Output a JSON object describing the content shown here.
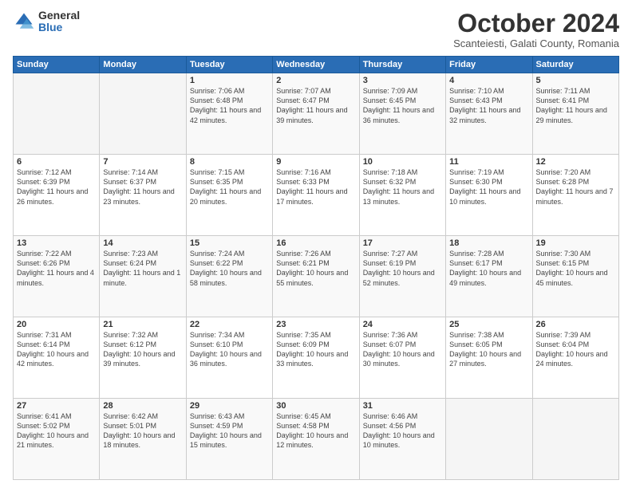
{
  "header": {
    "logo_general": "General",
    "logo_blue": "Blue",
    "month": "October 2024",
    "location": "Scanteiesti, Galati County, Romania"
  },
  "days_of_week": [
    "Sunday",
    "Monday",
    "Tuesday",
    "Wednesday",
    "Thursday",
    "Friday",
    "Saturday"
  ],
  "weeks": [
    [
      {
        "day": "",
        "info": ""
      },
      {
        "day": "",
        "info": ""
      },
      {
        "day": "1",
        "info": "Sunrise: 7:06 AM\nSunset: 6:48 PM\nDaylight: 11 hours and 42 minutes."
      },
      {
        "day": "2",
        "info": "Sunrise: 7:07 AM\nSunset: 6:47 PM\nDaylight: 11 hours and 39 minutes."
      },
      {
        "day": "3",
        "info": "Sunrise: 7:09 AM\nSunset: 6:45 PM\nDaylight: 11 hours and 36 minutes."
      },
      {
        "day": "4",
        "info": "Sunrise: 7:10 AM\nSunset: 6:43 PM\nDaylight: 11 hours and 32 minutes."
      },
      {
        "day": "5",
        "info": "Sunrise: 7:11 AM\nSunset: 6:41 PM\nDaylight: 11 hours and 29 minutes."
      }
    ],
    [
      {
        "day": "6",
        "info": "Sunrise: 7:12 AM\nSunset: 6:39 PM\nDaylight: 11 hours and 26 minutes."
      },
      {
        "day": "7",
        "info": "Sunrise: 7:14 AM\nSunset: 6:37 PM\nDaylight: 11 hours and 23 minutes."
      },
      {
        "day": "8",
        "info": "Sunrise: 7:15 AM\nSunset: 6:35 PM\nDaylight: 11 hours and 20 minutes."
      },
      {
        "day": "9",
        "info": "Sunrise: 7:16 AM\nSunset: 6:33 PM\nDaylight: 11 hours and 17 minutes."
      },
      {
        "day": "10",
        "info": "Sunrise: 7:18 AM\nSunset: 6:32 PM\nDaylight: 11 hours and 13 minutes."
      },
      {
        "day": "11",
        "info": "Sunrise: 7:19 AM\nSunset: 6:30 PM\nDaylight: 11 hours and 10 minutes."
      },
      {
        "day": "12",
        "info": "Sunrise: 7:20 AM\nSunset: 6:28 PM\nDaylight: 11 hours and 7 minutes."
      }
    ],
    [
      {
        "day": "13",
        "info": "Sunrise: 7:22 AM\nSunset: 6:26 PM\nDaylight: 11 hours and 4 minutes."
      },
      {
        "day": "14",
        "info": "Sunrise: 7:23 AM\nSunset: 6:24 PM\nDaylight: 11 hours and 1 minute."
      },
      {
        "day": "15",
        "info": "Sunrise: 7:24 AM\nSunset: 6:22 PM\nDaylight: 10 hours and 58 minutes."
      },
      {
        "day": "16",
        "info": "Sunrise: 7:26 AM\nSunset: 6:21 PM\nDaylight: 10 hours and 55 minutes."
      },
      {
        "day": "17",
        "info": "Sunrise: 7:27 AM\nSunset: 6:19 PM\nDaylight: 10 hours and 52 minutes."
      },
      {
        "day": "18",
        "info": "Sunrise: 7:28 AM\nSunset: 6:17 PM\nDaylight: 10 hours and 49 minutes."
      },
      {
        "day": "19",
        "info": "Sunrise: 7:30 AM\nSunset: 6:15 PM\nDaylight: 10 hours and 45 minutes."
      }
    ],
    [
      {
        "day": "20",
        "info": "Sunrise: 7:31 AM\nSunset: 6:14 PM\nDaylight: 10 hours and 42 minutes."
      },
      {
        "day": "21",
        "info": "Sunrise: 7:32 AM\nSunset: 6:12 PM\nDaylight: 10 hours and 39 minutes."
      },
      {
        "day": "22",
        "info": "Sunrise: 7:34 AM\nSunset: 6:10 PM\nDaylight: 10 hours and 36 minutes."
      },
      {
        "day": "23",
        "info": "Sunrise: 7:35 AM\nSunset: 6:09 PM\nDaylight: 10 hours and 33 minutes."
      },
      {
        "day": "24",
        "info": "Sunrise: 7:36 AM\nSunset: 6:07 PM\nDaylight: 10 hours and 30 minutes."
      },
      {
        "day": "25",
        "info": "Sunrise: 7:38 AM\nSunset: 6:05 PM\nDaylight: 10 hours and 27 minutes."
      },
      {
        "day": "26",
        "info": "Sunrise: 7:39 AM\nSunset: 6:04 PM\nDaylight: 10 hours and 24 minutes."
      }
    ],
    [
      {
        "day": "27",
        "info": "Sunrise: 6:41 AM\nSunset: 5:02 PM\nDaylight: 10 hours and 21 minutes."
      },
      {
        "day": "28",
        "info": "Sunrise: 6:42 AM\nSunset: 5:01 PM\nDaylight: 10 hours and 18 minutes."
      },
      {
        "day": "29",
        "info": "Sunrise: 6:43 AM\nSunset: 4:59 PM\nDaylight: 10 hours and 15 minutes."
      },
      {
        "day": "30",
        "info": "Sunrise: 6:45 AM\nSunset: 4:58 PM\nDaylight: 10 hours and 12 minutes."
      },
      {
        "day": "31",
        "info": "Sunrise: 6:46 AM\nSunset: 4:56 PM\nDaylight: 10 hours and 10 minutes."
      },
      {
        "day": "",
        "info": ""
      },
      {
        "day": "",
        "info": ""
      }
    ]
  ]
}
